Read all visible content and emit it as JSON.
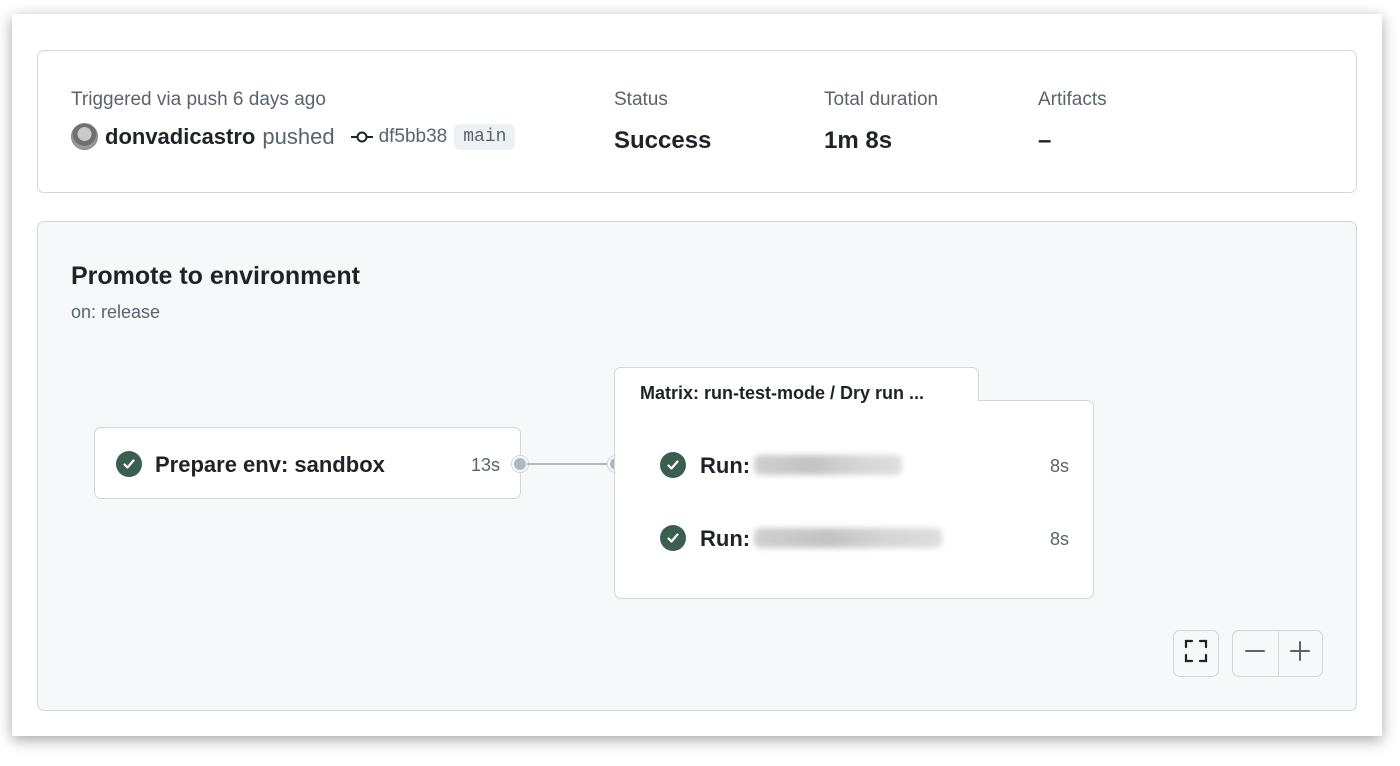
{
  "summary": {
    "triggered_label": "Triggered via push 6 days ago",
    "actor": "donvadicastro",
    "action": "pushed",
    "commit_sha": "df5bb38",
    "branch": "main",
    "status_label": "Status",
    "status_value": "Success",
    "duration_label": "Total duration",
    "duration_value": "1m 8s",
    "artifacts_label": "Artifacts",
    "artifacts_value": "–"
  },
  "workflow": {
    "title": "Promote to environment",
    "trigger": "on: release",
    "job": {
      "name": "Prepare env: sandbox",
      "duration": "13s",
      "status": "success"
    },
    "matrix": {
      "title": "Matrix: run-test-mode / Dry run ...",
      "runs": [
        {
          "label": "Run:",
          "duration": "8s",
          "status": "success"
        },
        {
          "label": "Run:",
          "duration": "8s",
          "status": "success"
        }
      ]
    }
  },
  "controls": {
    "fullscreen_icon": "fullscreen-icon",
    "zoom_out_icon": "minus-icon",
    "zoom_in_icon": "plus-icon"
  },
  "colors": {
    "success": "#3b5f4f",
    "border": "#d0d7de",
    "muted_text": "#59636e",
    "canvas_bg": "#f6f8fa"
  }
}
